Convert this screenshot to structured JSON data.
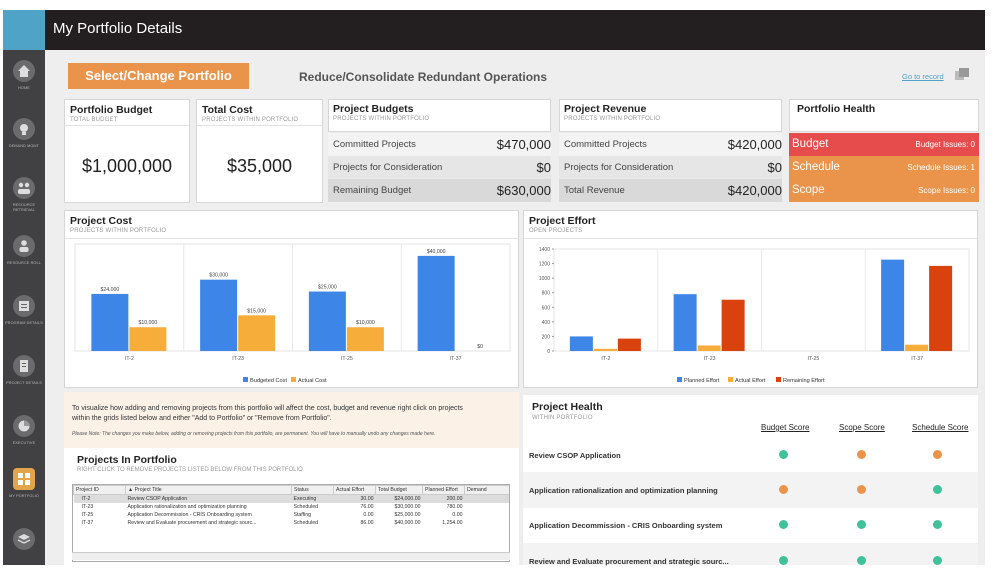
{
  "app": {
    "title": "My Portfolio Details"
  },
  "colors": {
    "accent": "#4fa3c7",
    "orange": "#ea934a",
    "red": "#e74c4c",
    "green": "#3fc29a",
    "blue": "#3d86e8",
    "yellow": "#f7ad3a",
    "deep_red": "#d9420c"
  },
  "sidebar": {
    "items": [
      {
        "label": "HOME",
        "icon": "home-icon"
      },
      {
        "label": "DEMAND MGMT",
        "icon": "lightbulb-icon"
      },
      {
        "label": "RESOURCE RETRIEVAL",
        "icon": "people-icon"
      },
      {
        "label": "RESOURCE ROLL",
        "icon": "person-icon"
      },
      {
        "label": "PROGRAM DETAILS",
        "icon": "program-icon"
      },
      {
        "label": "PROJECT DETAILS",
        "icon": "project-icon"
      },
      {
        "label": "EXECUTIVE",
        "icon": "pie-icon"
      },
      {
        "label": "MY PORTFOLIO",
        "icon": "portfolio-icon"
      },
      {
        "label": "",
        "icon": "layers-icon"
      }
    ]
  },
  "toolbar": {
    "select_label": "Select/Change Portfolio",
    "portfolio_name": "Reduce/Consolidate Redundant Operations",
    "goto_label": "Go to record"
  },
  "cards": {
    "budget": {
      "title": "Portfolio Budget",
      "subtitle": "TOTAL BUDGET",
      "value": "$1,000,000"
    },
    "cost": {
      "title": "Total Cost",
      "subtitle": "PROJECTS WITHIN PORTFOLIO",
      "value": "$35,000"
    },
    "project_budgets": {
      "title": "Project Budgets",
      "subtitle": "PROJECTS WITHIN PORTFOLIO",
      "rows": [
        {
          "label": "Committed Projects",
          "value": "$470,000"
        },
        {
          "label": "Projects for Consideration",
          "value": "$0"
        },
        {
          "label": "Remaining Budget",
          "value": "$630,000"
        }
      ]
    },
    "project_revenue": {
      "title": "Project Revenue",
      "subtitle": "PROJECTS WITHIN PORTFOLIO",
      "rows": [
        {
          "label": "Committed Projects",
          "value": "$420,000"
        },
        {
          "label": "Projects for Consideration",
          "value": "$0"
        },
        {
          "label": "Total Revenue",
          "value": "$420,000"
        }
      ]
    },
    "health": {
      "title": "Portfolio Health",
      "rows": [
        {
          "label": "Budget",
          "value": "Budget Issues: 0",
          "color": "#e74c4c"
        },
        {
          "label": "Schedule",
          "value": "Schedule Issues: 1",
          "color": "#ea934a"
        },
        {
          "label": "Scope",
          "value": "Scope Issues: 0",
          "color": "#ea934a"
        }
      ]
    }
  },
  "chart_data": [
    {
      "type": "bar",
      "title": "Project Cost",
      "subtitle": "PROJECTS WITHIN PORTFOLIO",
      "categories": [
        "IT-2",
        "IT-23",
        "IT-25",
        "IT-37"
      ],
      "ylim": [
        0,
        45000
      ],
      "series": [
        {
          "name": "Budgeted Cost",
          "color": "#3d86e8",
          "values": [
            24000,
            30000,
            25000,
            40000
          ],
          "labels": [
            "$24,000",
            "$30,000",
            "$25,000",
            "$40,000"
          ]
        },
        {
          "name": "Actual Cost",
          "color": "#f7ad3a",
          "values": [
            10000,
            15000,
            10000,
            0
          ],
          "labels": [
            "$10,000",
            "$15,000",
            "$10,000",
            "$0"
          ]
        }
      ]
    },
    {
      "type": "bar",
      "title": "Project Effort",
      "subtitle": "OPEN PROJECTS",
      "categories": [
        "IT-2",
        "IT-23",
        "IT-25",
        "IT-37"
      ],
      "ylim": [
        0,
        1400
      ],
      "yticks": [
        "0",
        "200",
        "400",
        "600",
        "800",
        "1000",
        "1200",
        "1400"
      ],
      "series": [
        {
          "name": "Planned Effort",
          "color": "#3d86e8",
          "values": [
            200,
            780,
            0,
            1254
          ]
        },
        {
          "name": "Actual Effort",
          "color": "#f7ad3a",
          "values": [
            30,
            76,
            0,
            86
          ]
        },
        {
          "name": "Remaining Effort",
          "color": "#d9420c",
          "values": [
            170,
            704,
            0,
            1168
          ]
        }
      ]
    }
  ],
  "info": {
    "text1": "To visualize how adding and removing projects from this portfolio will affect the cost, budget and revenue right click on projects",
    "text2": "within the grids listed below and either \"Add to Portfolio\" or \"Remove from Portfolio\".",
    "note": "Please Note: The changes you make below, adding or removing projects from this portfolio, are permanent. You will have to manually undo any changes made here."
  },
  "projects_in_portfolio": {
    "title": "Projects In Portfolio",
    "subtitle": "RIGHT CLICK TO REMOVE PROJECTS LISTED BELOW FROM THIS PORTFOLIO",
    "columns": [
      "Project ID",
      "Project Title",
      "Status",
      "Actual Effort",
      "Total Budget",
      "Planned Effort",
      "Demand"
    ],
    "rows": [
      [
        "IT-2",
        "Review CSOP Application",
        "Executing",
        "30.00",
        "$24,000.00",
        "200.00",
        "$"
      ],
      [
        "IT-23",
        "Application rationalization and optimization planning",
        "Scheduled",
        "76.00",
        "$30,000.00",
        "780.00",
        "$"
      ],
      [
        "IT-25",
        "Application Decommission - CRIS Onboarding system",
        "Staffing",
        "0.00",
        "$25,000.00",
        "0.00",
        "$"
      ],
      [
        "IT-37",
        "Review and Evaluate procurement and strategic sourc...",
        "Scheduled",
        "86.00",
        "$40,000.00",
        "1,254.00",
        "$"
      ]
    ]
  },
  "project_health": {
    "title": "Project Health",
    "subtitle": "WITHIN PORTFOLIO",
    "columns": [
      "Budget Score",
      "Scope Score",
      "Schedule Score"
    ],
    "rows": [
      {
        "name": "Review CSOP Application",
        "scores": [
          "green",
          "orange",
          "orange"
        ]
      },
      {
        "name": "Application rationalization and optimization planning",
        "scores": [
          "orange",
          "orange",
          "green"
        ]
      },
      {
        "name": "Application Decommission -  CRIS Onboarding system",
        "scores": [
          "green",
          "green",
          "green"
        ]
      },
      {
        "name": "Review and Evaluate procurement and strategic sourc...",
        "scores": [
          "green",
          "green",
          "green"
        ]
      }
    ]
  }
}
